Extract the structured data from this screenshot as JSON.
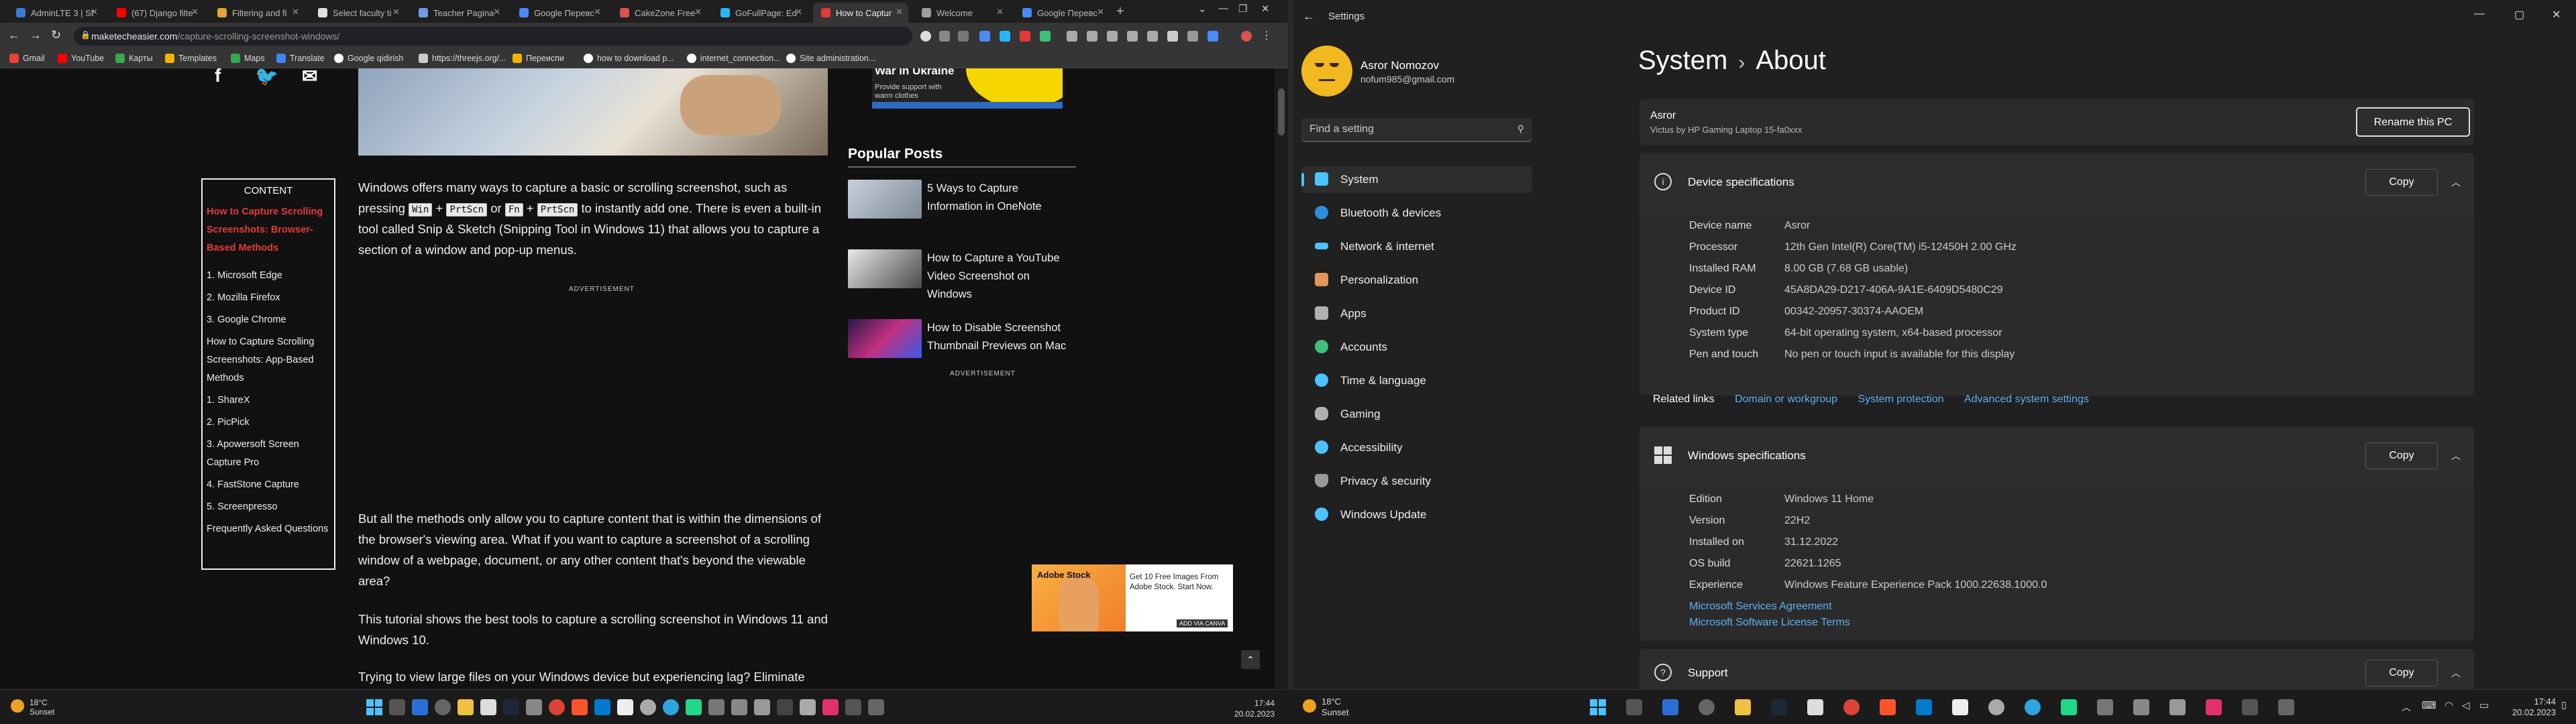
{
  "browser": {
    "tabs": [
      {
        "label": "AdminLTE 3 | St",
        "color": "#3a7bd5"
      },
      {
        "label": "(67) Django filte",
        "color": "#ff0000"
      },
      {
        "label": "Filtering and fi",
        "color": "#e8a23a"
      },
      {
        "label": "Select faculty ti",
        "color": "#e0e0e0"
      },
      {
        "label": "Teacher Pagina",
        "color": "#6f9be8"
      },
      {
        "label": "Google Перевс",
        "color": "#4a8af4"
      },
      {
        "label": "CakeZone Free",
        "color": "#d9534f"
      },
      {
        "label": "GoFullPage: Ed",
        "color": "#29b6f6"
      },
      {
        "label": "How to Captur",
        "color": "#e53935",
        "active": true
      },
      {
        "label": "Welcome",
        "color": "#9e9e9e"
      },
      {
        "label": "Google Перевс",
        "color": "#4a8af4"
      }
    ],
    "url": {
      "host": "maketecheasier.com",
      "path": "/capture-scrolling-screenshot-windows/"
    },
    "bookmarks": [
      {
        "label": "Gmail",
        "color": "#ea4335"
      },
      {
        "label": "YouTube",
        "color": "#ff0000"
      },
      {
        "label": "Карты",
        "color": "#34a853"
      },
      {
        "label": "Templates",
        "color": "#f4b400"
      },
      {
        "label": "Maps",
        "color": "#34a853"
      },
      {
        "label": "Translate",
        "color": "#4285f4"
      },
      {
        "label": "Google qidirish",
        "color": "#ffffff"
      },
      {
        "label": "https://threejs.org/...",
        "color": "#cccccc"
      },
      {
        "label": "Переиспи",
        "color": "#f4b400"
      },
      {
        "label": "how to download p...",
        "color": "#ffffff"
      },
      {
        "label": "internet_connection...",
        "color": "#ffffff"
      },
      {
        "label": "Site administration...",
        "color": "#ffffff"
      }
    ]
  },
  "article": {
    "toc_title": "CONTENT",
    "toc": [
      "How to Capture Scrolling Screenshots: Browser-Based Methods",
      "1. Microsoft Edge",
      "2. Mozilla Firefox",
      "3. Google Chrome",
      "How to Capture Scrolling Screenshots: App-Based Methods",
      "1. ShareX",
      "2. PicPick",
      "3. Apowersoft Screen Capture Pro",
      "4. FastStone Capture",
      "5. Screenpresso",
      "Frequently Asked Questions"
    ],
    "p1_a": "Windows offers many ways to capture a basic or scrolling screenshot, such as pressing",
    "key_win": "Win",
    "plus": "+",
    "key_prtscn": "PrtScn",
    "or": "or",
    "key_fn": "Fn",
    "p1_b": "to instantly add one. There is even a built-in tool called Snip & Sketch (Snipping Tool in Windows 11) that allows you to capture a section of a window and pop-up menus.",
    "ad_label": "ADVERTISEMENT",
    "p2": "But all the methods only allow you to capture content that is within the dimensions of the browser's viewing area. What if you want to capture a screenshot of a scrolling window of a webpage, document, or any other content that's beyond the viewable area?",
    "p3": "This tutorial shows the best tools to capture a scrolling screenshot in Windows 11 and Windows 10.",
    "p4": "Trying to view large files on your Windows device but experiencing lag? Eliminate"
  },
  "sidebar_ad": {
    "title": "War in Ukraine",
    "sub": "Provide support with warm clothes"
  },
  "popular": {
    "heading": "Popular Posts",
    "posts": [
      {
        "title": "5 Ways to Capture Information in OneNote",
        "color": "#9aa8b8"
      },
      {
        "title": "How to Capture a YouTube Video Screenshot on Windows",
        "color": "#6d6d6d"
      },
      {
        "title": "How to Disable Screenshot Thumbnail Previews on Mac",
        "color": "#7b3fa8"
      }
    ],
    "ad_label": "ADVERTISEMENT"
  },
  "adobe_ad": {
    "logo": "Adobe Stock",
    "text": "Get 10 Free Images From Adobe Stock. Start Now.",
    "button": "ADD VIA CANVA"
  },
  "settings": {
    "window_title": "Settings",
    "user_name": "Asror Nomozov",
    "user_email": "nofum985@gmail.com",
    "search_placeholder": "Find a setting",
    "nav": [
      {
        "label": "System",
        "icon": "system-icon",
        "color": "#4cc2ff",
        "selected": true
      },
      {
        "label": "Bluetooth & devices",
        "icon": "bluetooth-icon",
        "color": "#2b8ee0"
      },
      {
        "label": "Network & internet",
        "icon": "network-icon",
        "color": "#4cc2ff"
      },
      {
        "label": "Personalization",
        "icon": "brush-icon",
        "color": "#e0955c"
      },
      {
        "label": "Apps",
        "icon": "apps-icon",
        "color": "#b0b0b0"
      },
      {
        "label": "Accounts",
        "icon": "accounts-icon",
        "color": "#3ec07a"
      },
      {
        "label": "Time & language",
        "icon": "globe-icon",
        "color": "#4cc2ff"
      },
      {
        "label": "Gaming",
        "icon": "gaming-icon",
        "color": "#b0b0b0"
      },
      {
        "label": "Accessibility",
        "icon": "accessibility-icon",
        "color": "#4cc2ff"
      },
      {
        "label": "Privacy & security",
        "icon": "shield-icon",
        "color": "#9a9a9a"
      },
      {
        "label": "Windows Update",
        "icon": "update-icon",
        "color": "#4cc2ff"
      }
    ],
    "crumb_parent": "System",
    "crumb_sep": "›",
    "crumb_current": "About",
    "device_name": "Asror",
    "device_model": "Victus by HP Gaming Laptop 15-fa0xxx",
    "rename_button": "Rename this PC",
    "device_specs": {
      "title": "Device specifications",
      "copy": "Copy",
      "rows": [
        {
          "label": "Device name",
          "value": "Asror"
        },
        {
          "label": "Processor",
          "value": "12th Gen Intel(R) Core(TM) i5-12450H   2.00 GHz"
        },
        {
          "label": "Installed RAM",
          "value": "8.00 GB (7.68 GB usable)"
        },
        {
          "label": "Device ID",
          "value": "45A8DA29-D217-406A-9A1E-6409D5480C29"
        },
        {
          "label": "Product ID",
          "value": "00342-20957-30374-AAOEM"
        },
        {
          "label": "System type",
          "value": "64-bit operating system, x64-based processor"
        },
        {
          "label": "Pen and touch",
          "value": "No pen or touch input is available for this display"
        }
      ]
    },
    "related_links": {
      "label": "Related links",
      "links": [
        "Domain or workgroup",
        "System protection",
        "Advanced system settings"
      ]
    },
    "win_specs": {
      "title": "Windows specifications",
      "copy": "Copy",
      "rows": [
        {
          "label": "Edition",
          "value": "Windows 11 Home"
        },
        {
          "label": "Version",
          "value": "22H2"
        },
        {
          "label": "Installed on",
          "value": "31.12.2022"
        },
        {
          "label": "OS build",
          "value": "22621.1265"
        },
        {
          "label": "Experience",
          "value": "Windows Feature Experience Pack 1000.22638.1000.0"
        }
      ],
      "links": [
        "Microsoft Services Agreement",
        "Microsoft Software License Terms"
      ]
    },
    "support": {
      "title": "Support",
      "copy": "Copy"
    }
  },
  "taskbar_left": {
    "temp": "18°C",
    "weather": "Sunset",
    "time": "17:44",
    "date": "20.02.2023"
  },
  "taskbar_right": {
    "temp": "18°C",
    "weather": "Sunset",
    "time": "17:44",
    "date": "20.02.2023"
  }
}
